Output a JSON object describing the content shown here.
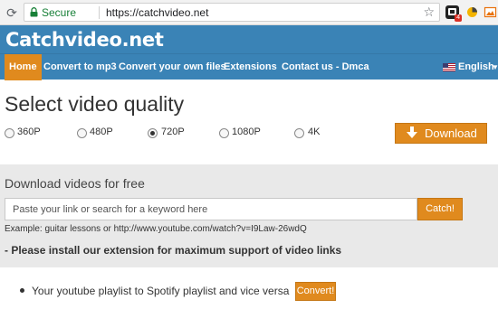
{
  "browser": {
    "secure_label": "Secure",
    "url": "https://catchvideo.net",
    "extension_badge": "4"
  },
  "site": {
    "brand": "Catchvideo.net"
  },
  "nav": {
    "items": [
      {
        "label": "Home"
      },
      {
        "label": "Convert to mp3"
      },
      {
        "label": "Convert your own files"
      },
      {
        "label": "Extensions"
      },
      {
        "label": "Contact us - Dmca"
      }
    ],
    "language": "English"
  },
  "quality": {
    "title": "Select video quality",
    "options": [
      {
        "label": "360P"
      },
      {
        "label": "480P"
      },
      {
        "label": "720P"
      },
      {
        "label": "1080P"
      },
      {
        "label": "4K"
      }
    ],
    "selected": "720P",
    "download_label": "Download"
  },
  "search": {
    "heading": "Download videos for free",
    "placeholder": "Paste your link or search for a keyword here",
    "button": "Catch!",
    "example": "Example: guitar lessons or http://www.youtube.com/watch?v=I9Law-26wdQ",
    "notice": "- Please install our extension for maximum support of video links"
  },
  "promo": {
    "text": "Your youtube playlist to Spotify playlist and vice versa",
    "button": "Convert!"
  },
  "colors": {
    "header": "#3a83b6",
    "accent": "#e08a1e",
    "secure": "#188038"
  }
}
